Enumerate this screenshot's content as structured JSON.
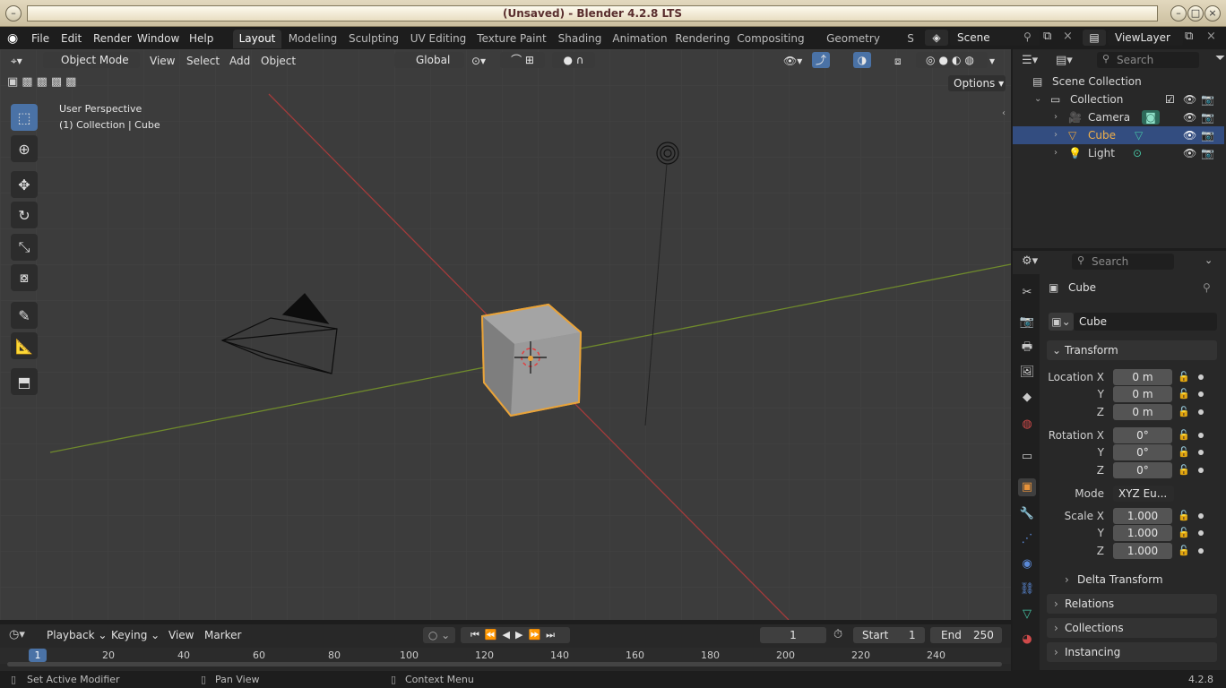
{
  "window": {
    "title": "(Unsaved) - Blender 4.2.8 LTS"
  },
  "menu": [
    "File",
    "Edit",
    "Render",
    "Window",
    "Help"
  ],
  "workspaces": [
    "Layout",
    "Modeling",
    "Sculpting",
    "UV Editing",
    "Texture Paint",
    "Shading",
    "Animation",
    "Rendering",
    "Compositing",
    "Geometry Nodes",
    "S"
  ],
  "scene": {
    "name": "Scene",
    "view_layer": "ViewLayer"
  },
  "viewport": {
    "mode": "Object Mode",
    "menus": [
      "View",
      "Select",
      "Add",
      "Object"
    ],
    "orientation": "Global",
    "options": "Options",
    "overlay_line1": "User Perspective",
    "overlay_line2": "(1) Collection | Cube"
  },
  "outliner": {
    "search_placeholder": "Search",
    "scene_collection": "Scene Collection",
    "collection": "Collection",
    "items": [
      "Camera",
      "Cube",
      "Light"
    ]
  },
  "properties": {
    "search_placeholder": "Search",
    "object_name": "Cube",
    "data_name": "Cube",
    "transform": "Transform",
    "location_label": "Location X",
    "rotation_label": "Rotation X",
    "scale_label": "Scale X",
    "y": "Y",
    "z": "Z",
    "location": [
      "0 m",
      "0 m",
      "0 m"
    ],
    "rotation": [
      "0°",
      "0°",
      "0°"
    ],
    "mode_label": "Mode",
    "mode_value": "XYZ Eu...",
    "scale": [
      "1.000",
      "1.000",
      "1.000"
    ],
    "delta_transform": "Delta Transform",
    "relations": "Relations",
    "collections": "Collections",
    "instancing": "Instancing"
  },
  "timeline": {
    "menus": [
      "Playback",
      "Keying",
      "View",
      "Marker"
    ],
    "current_frame": "1",
    "start_label": "Start",
    "start": "1",
    "end_label": "End",
    "end": "250",
    "ticks": [
      "1",
      "20",
      "40",
      "60",
      "80",
      "100",
      "120",
      "140",
      "160",
      "180",
      "200",
      "220",
      "240"
    ]
  },
  "status": {
    "left": "Set Active Modifier",
    "middle": "Pan View",
    "right": "Context Menu",
    "version": "4.2.8"
  },
  "colors": {
    "accent": "#4a72a6",
    "selected_orange": "#e8a33a",
    "x_axis": "#a33b3b",
    "y_axis": "#6f8a2c"
  }
}
